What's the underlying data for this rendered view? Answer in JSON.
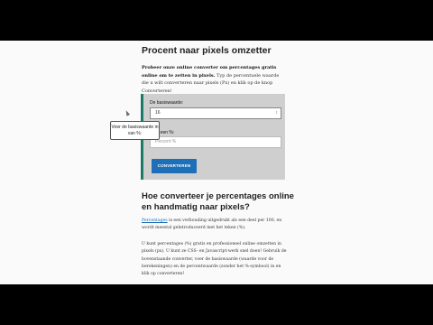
{
  "page": {
    "title": "Procent naar pixels omzetter",
    "intro_bold": "Probeer onze online converter om percentages gratis online om te zetten in pixels.",
    "intro_rest": " Typ de percentuele waarde die u wilt converteren naar pixels (Px) en klik op de knop Converteren!"
  },
  "calculator": {
    "base_label": "De basiswaarde:",
    "base_value": "16",
    "base_spin": "↕",
    "percent_label": "Voer een %:",
    "percent_placeholder": "Percent %",
    "convert_button": "CONVERTEREN"
  },
  "tooltip": {
    "text": "Voer de basiswaarde in van %:"
  },
  "article": {
    "heading": "Hoe converteer je percentages online en handmatig naar pixels?",
    "p1_link": "Percentages",
    "p1_rest": " is een verhouding uitgedrukt als een deel per 100, en wordt meestal geïntroduceerd met het teken (%).",
    "p2": "U kunt percentages (%) gratis en professioneel online omzetten in pixels (px). U kunt ze CSS- en Javascript-werk snel doen! Gebruik de bovenstaande converter, voer de basiswaarde (waarde voor de berekeningen) en de percentwaarde (zonder het %-symbool) in en klik op converteren!"
  },
  "colors": {
    "accent_bar": "#1e7a68",
    "button": "#1d6fb8",
    "panel": "#cfcfcf"
  }
}
